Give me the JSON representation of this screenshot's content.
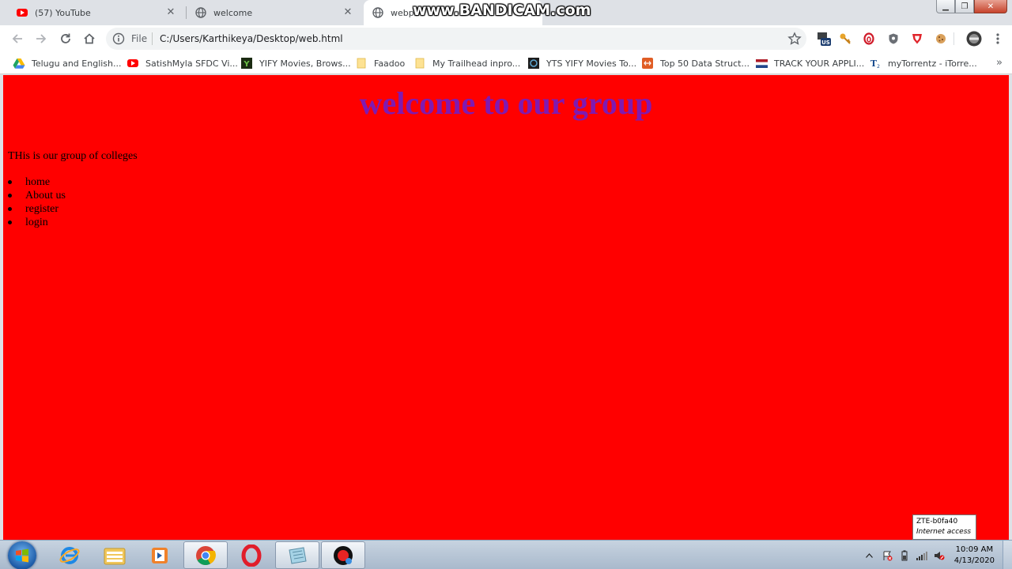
{
  "browser": {
    "tabs": [
      {
        "title": "(57) YouTube",
        "icon": "youtube-icon"
      },
      {
        "title": "welcome",
        "icon": "globe-icon"
      },
      {
        "title": "webpa",
        "icon": "globe-icon"
      }
    ],
    "watermark": "www.BANDICAM.com",
    "address": {
      "scheme_label": "File",
      "url": "C:/Users/Karthikeya/Desktop/web.html"
    },
    "extensions": [
      "us-flag-icon",
      "key-icon",
      "opera-icon",
      "shield-icon",
      "brave-shield-icon",
      "cookie-icon",
      "profile-avatar"
    ],
    "bookmarks": [
      {
        "label": "Telugu and English...",
        "icon": "google-drive-icon"
      },
      {
        "label": "SatishMyla SFDC Vi...",
        "icon": "youtube-icon"
      },
      {
        "label": "YIFY Movies, Brows...",
        "icon": "yify-icon"
      },
      {
        "label": "Faadoo",
        "icon": "folder-icon"
      },
      {
        "label": "My Trailhead inpro...",
        "icon": "folder-icon"
      },
      {
        "label": "YTS YIFY Movies To...",
        "icon": "yts-icon"
      },
      {
        "label": "Top 50 Data Struct...",
        "icon": "geeks-icon"
      },
      {
        "label": "TRACK YOUR APPLI...",
        "icon": "flag-icon"
      },
      {
        "label": "myTorrentz - iTorre...",
        "icon": "torrent-icon"
      }
    ]
  },
  "page": {
    "background": "#ff0000",
    "heading": "welcome to our group",
    "heading_color": "#6a1fd0",
    "paragraph": "THis is our group of colleges",
    "menu": [
      "home",
      "About us",
      "register",
      "login"
    ]
  },
  "tooltip": {
    "line1": "ZTE-b0fa40",
    "line2": "Internet access"
  },
  "taskbar": {
    "apps": [
      "ie-icon",
      "explorer-icon",
      "media-player-icon",
      "chrome-icon",
      "opera-icon",
      "notepad-icon",
      "bandicam-icon"
    ],
    "clock": {
      "time": "10:09 AM",
      "date": "4/13/2020"
    }
  }
}
